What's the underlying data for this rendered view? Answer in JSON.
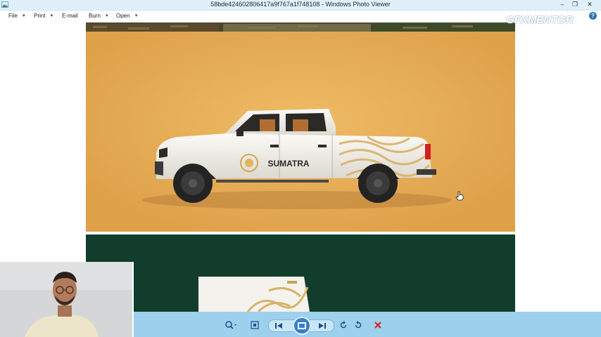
{
  "window": {
    "title": "58bde424602806417a9f767a1f748108 - Windows Photo Viewer",
    "minimize_icon": "minimize-icon",
    "restore_icon": "restore-icon",
    "close_icon": "close-icon"
  },
  "menu": {
    "items": [
      {
        "label": "File",
        "has_dropdown": true
      },
      {
        "label": "Print",
        "has_dropdown": true
      },
      {
        "label": "E-mail",
        "has_dropdown": false
      },
      {
        "label": "Burn",
        "has_dropdown": true
      },
      {
        "label": "Open",
        "has_dropdown": true
      }
    ],
    "help_label": "?"
  },
  "overlay": {
    "brand_logo": "GFXMENTOR"
  },
  "photo": {
    "truck_label": "SUMATRA",
    "colors": {
      "orange_panel": "#e6ac55",
      "green_panel": "#123d2c",
      "truck_body": "#f4f1ea",
      "pattern_gold": "#d9b268"
    }
  },
  "toolbar": {
    "buttons": [
      {
        "name": "zoom",
        "icon": "magnifier-icon"
      },
      {
        "name": "actual-size",
        "icon": "fit-window-icon"
      },
      {
        "name": "previous",
        "icon": "previous-icon"
      },
      {
        "name": "slideshow",
        "icon": "slideshow-icon"
      },
      {
        "name": "next",
        "icon": "next-icon"
      },
      {
        "name": "rotate-counterclockwise",
        "icon": "rotate-left-icon"
      },
      {
        "name": "rotate-clockwise",
        "icon": "rotate-right-icon"
      },
      {
        "name": "delete",
        "icon": "delete-icon"
      }
    ]
  }
}
